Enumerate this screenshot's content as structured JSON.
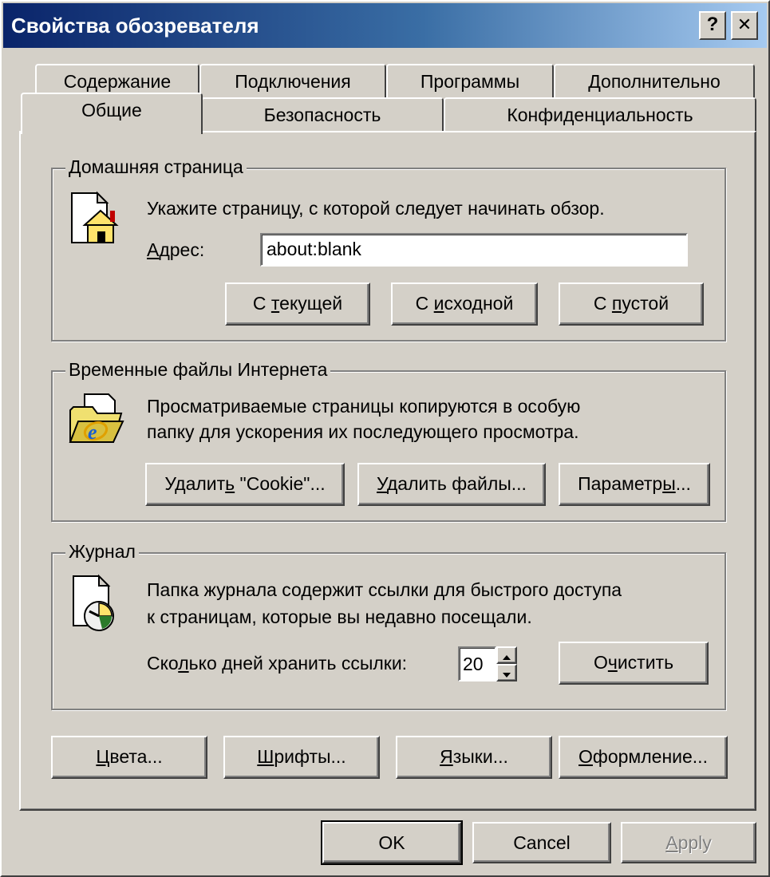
{
  "window": {
    "title": "Свойства обозревателя",
    "help_glyph": "?",
    "close_glyph": "✕"
  },
  "tabs": {
    "row1": [
      "Содержание",
      "Подключения",
      "Программы",
      "Дополнительно"
    ],
    "row2": [
      "Общие",
      "Безопасность",
      "Конфиденциальность"
    ],
    "selected": "Общие"
  },
  "home": {
    "legend": "Домашняя страница",
    "description": "Укажите страницу, с которой следует начинать обзор.",
    "address_label": "Адрес:",
    "address_value": "about:blank",
    "btn_current": [
      "С ",
      "т",
      "екущей"
    ],
    "btn_default": [
      "С ",
      "и",
      "сходной"
    ],
    "btn_blank": [
      "С ",
      "п",
      "устой"
    ]
  },
  "temp": {
    "legend": "Временные файлы Интернета",
    "line1": "Просматриваемые страницы копируются в особую",
    "line2": "папку для ускорения их последующего просмотра.",
    "btn_cookies": [
      "Удалит",
      "ь",
      " \"Cookie\"..."
    ],
    "btn_files": [
      "",
      "У",
      "далить файлы..."
    ],
    "btn_settings": [
      "Параметр",
      "ы",
      "..."
    ]
  },
  "history": {
    "legend": "Журнал",
    "line1": "Папка журнала содержит ссылки для быстрого доступа",
    "line2": "к страницам, которые вы недавно посещали.",
    "days_label": [
      "Ско",
      "л",
      "ько дней хранить ссылки:"
    ],
    "days_value": "20",
    "btn_clear": [
      "О",
      "ч",
      "истить"
    ]
  },
  "bottom_buttons": {
    "colors": [
      "",
      "Ц",
      "вета..."
    ],
    "fonts": [
      "",
      "Ш",
      "рифты..."
    ],
    "languages": [
      "",
      "Я",
      "зыки..."
    ],
    "accessibility": [
      "",
      "О",
      "формление..."
    ]
  },
  "dialog_buttons": {
    "ok": "OK",
    "cancel": "Cancel",
    "apply": [
      "",
      "A",
      "pply"
    ]
  },
  "icons": {
    "home": "home-page-icon",
    "temp": "ie-folder-icon",
    "history": "history-clock-icon"
  },
  "colors": {
    "face": "#d4d0c8",
    "title_start": "#0a246a",
    "title_end": "#a6caf0"
  }
}
